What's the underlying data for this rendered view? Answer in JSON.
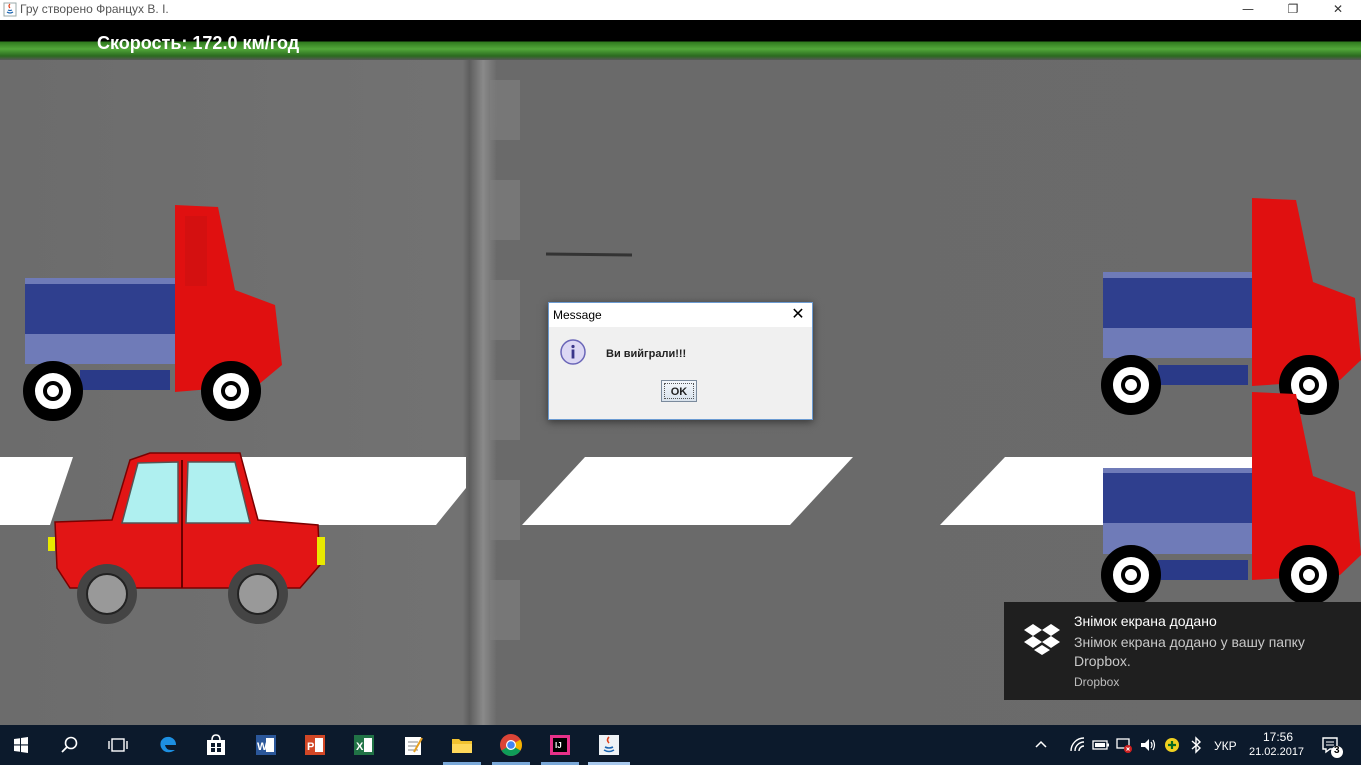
{
  "window": {
    "title": "Гру створено Францух В. І.",
    "minimize": "—",
    "restore": "❐",
    "close": "✕"
  },
  "game": {
    "speed_label": "Скорость: 172.0 км/год"
  },
  "dialog": {
    "title": "Message",
    "close": "✕",
    "message": "Ви вийграли!!!",
    "ok_label": "OK"
  },
  "notification": {
    "title": "Знімок екрана додано",
    "body": "Знімок екрана додано у вашу папку Dropbox.",
    "source": "Dropbox"
  },
  "taskbar": {
    "apps": [
      "start-icon",
      "search-icon",
      "task-view-icon",
      "edge-icon",
      "store-icon",
      "word-icon",
      "powerpoint-icon",
      "excel-icon",
      "notepad-icon",
      "file-explorer-icon",
      "chrome-icon",
      "intellij-icon",
      "java-icon"
    ],
    "language": "УКР",
    "time": "17:56",
    "date": "21.02.2017",
    "notification_count": "3"
  }
}
